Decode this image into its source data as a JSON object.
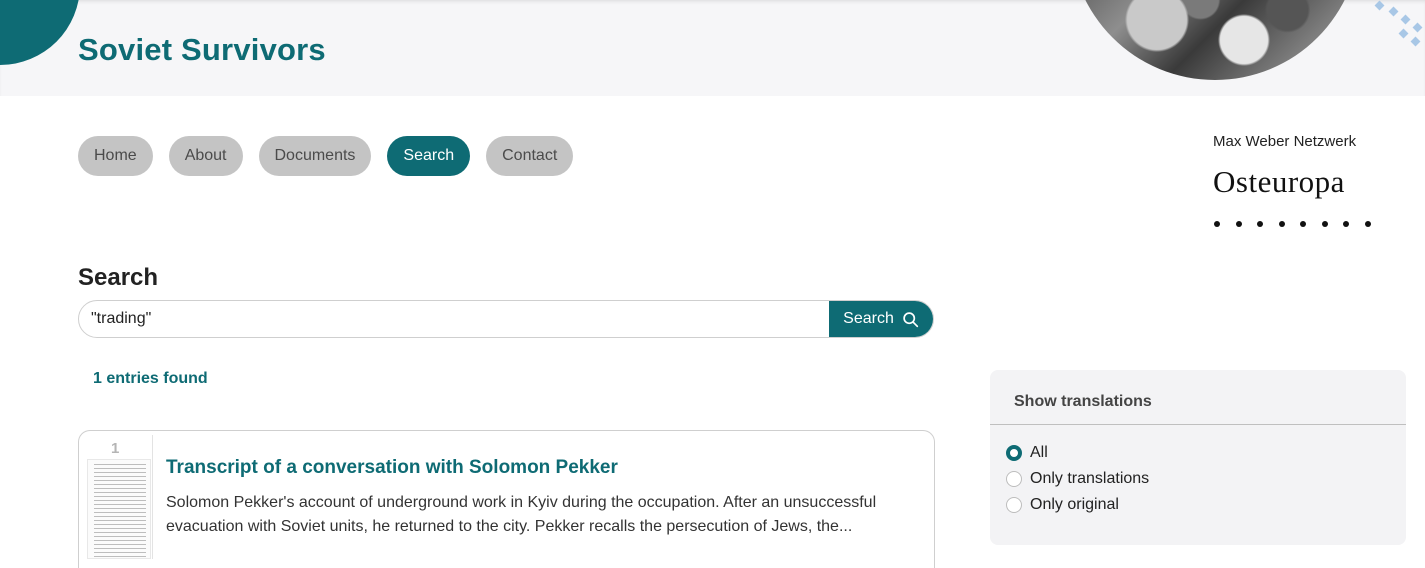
{
  "site": {
    "title": "Soviet Survivors"
  },
  "nav": {
    "items": [
      {
        "label": "Home",
        "active": false
      },
      {
        "label": "About",
        "active": false
      },
      {
        "label": "Documents",
        "active": false
      },
      {
        "label": "Search",
        "active": true
      },
      {
        "label": "Contact",
        "active": false
      }
    ]
  },
  "org": {
    "small": "Max Weber Netzwerk",
    "big": "Osteuropa"
  },
  "search": {
    "heading": "Search",
    "query": "\"trading\"",
    "button_label": "Search",
    "entries_found": "1 entries found"
  },
  "results": [
    {
      "number": "1",
      "title": "Transcript of a conversation with Solomon Pekker",
      "text_line1": "Solomon Pekker's account of underground work in Kyiv during the occupation. After an unsuccessful",
      "text_line2": "evacuation with Soviet units, he returned to the city. Pekker recalls the persecution of Jews, the..."
    }
  ],
  "filter": {
    "title": "Show translations",
    "options": [
      {
        "label": "All",
        "checked": true
      },
      {
        "label": "Only translations",
        "checked": false
      },
      {
        "label": "Only original",
        "checked": false
      }
    ]
  },
  "colors": {
    "accent": "#0e6b74",
    "pill": "#c4c4c4",
    "panel": "#f3f3f5"
  }
}
